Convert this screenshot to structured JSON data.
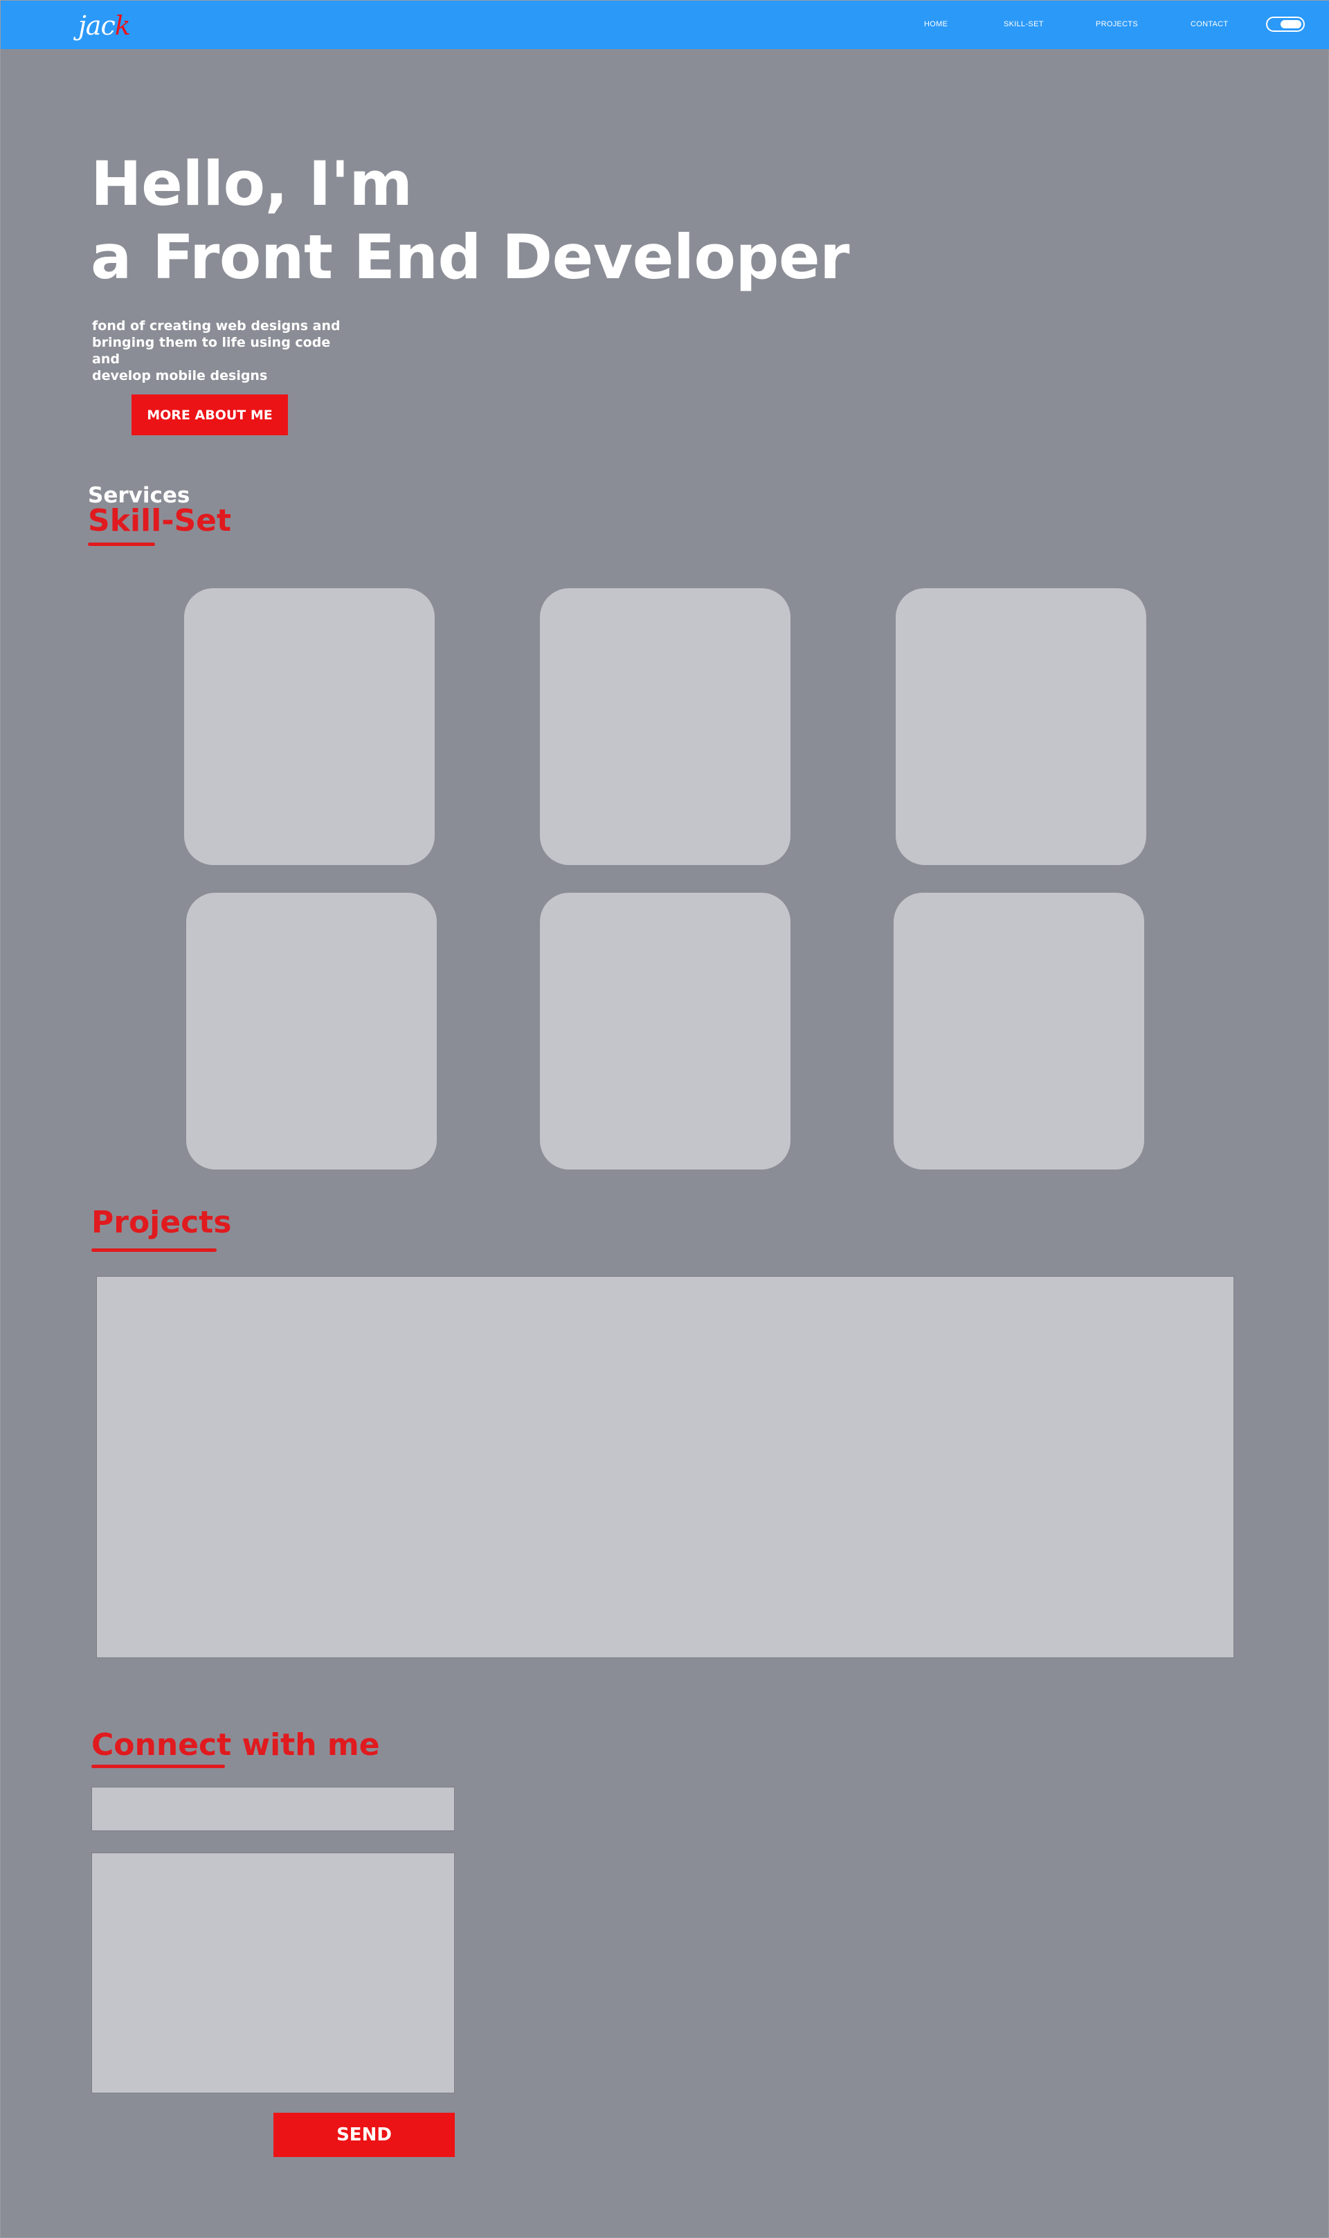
{
  "header": {
    "logo_main": "jac",
    "logo_accent": "k",
    "nav": {
      "home": "HOME",
      "skillset": "SKILL-SET",
      "projects": "PROJECTS",
      "contact": "CONTACT"
    },
    "theme_toggle": "on"
  },
  "hero": {
    "title_line1": "Hello, I'm",
    "title_line2": "a Front End Developer",
    "subtitle_line1": "fond of creating web designs and",
    "subtitle_line2": "bringing them to life using code and",
    "subtitle_line3": "develop mobile designs",
    "button_label": "MORE ABOUT ME"
  },
  "services": {
    "label": "Services",
    "heading": "Skill-Set"
  },
  "projects": {
    "heading": "Projects"
  },
  "contact": {
    "heading_part1": "Connect",
    "heading_part2": " with me",
    "input_value": "",
    "textarea_value": "",
    "send_label": "SEND"
  },
  "colors": {
    "navbar": "#2b99f8",
    "background": "#8b8d96",
    "accent_red": "#ec1316",
    "card": "#c4c5ca"
  }
}
